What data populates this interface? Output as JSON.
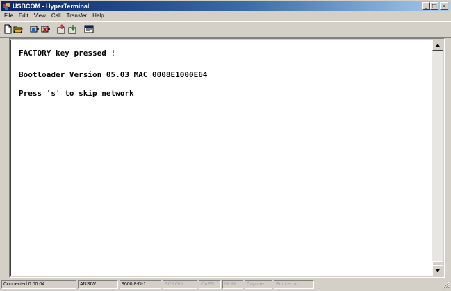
{
  "window": {
    "title": "USBCOM - HyperTerminal",
    "caption_buttons": {
      "minimize": "_",
      "maximize": "□",
      "close": "×"
    }
  },
  "menu": {
    "items": [
      "File",
      "Edit",
      "View",
      "Call",
      "Transfer",
      "Help"
    ]
  },
  "toolbar": {
    "buttons": [
      "new-icon",
      "open-icon",
      "connect-icon",
      "disconnect-icon",
      "send-icon",
      "receive-icon",
      "properties-icon"
    ]
  },
  "terminal": {
    "lines": [
      "FACTORY key pressed !",
      "Bootloader Version 05.03 MAC 0008E1000E64",
      "Press 's' to skip network"
    ]
  },
  "statusbar": {
    "connected": "Connected 0:00:04",
    "emulation": "ANSIW",
    "port_settings": "9600 8-N-1",
    "scroll": "SCROLL",
    "caps": "CAPS",
    "num": "NUM",
    "capture": "Capture",
    "print_echo": "Print echo"
  }
}
